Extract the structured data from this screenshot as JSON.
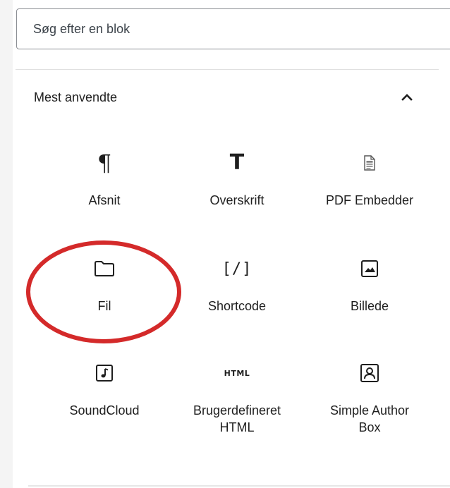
{
  "search": {
    "placeholder": "Søg efter en blok",
    "value": ""
  },
  "section": {
    "title": "Mest anvendte",
    "expanded": true,
    "chevron_icon": "chevron-up-icon"
  },
  "blocks": [
    {
      "label": "Afsnit",
      "icon": "paragraph-icon"
    },
    {
      "label": "Overskrift",
      "icon": "heading-icon"
    },
    {
      "label": "PDF Embedder",
      "icon": "pdf-document-icon"
    },
    {
      "label": "Fil",
      "icon": "folder-icon"
    },
    {
      "label": "Shortcode",
      "icon": "shortcode-icon",
      "glyph": "[/]"
    },
    {
      "label": "Billede",
      "icon": "image-icon"
    },
    {
      "label": "SoundCloud",
      "icon": "audio-icon"
    },
    {
      "label": "Brugerdefineret HTML",
      "icon": "html-icon",
      "glyph": "HTML"
    },
    {
      "label": "Simple Author Box",
      "icon": "author-box-icon"
    }
  ],
  "annotation": {
    "highlight_color": "#d42a2a",
    "highlighted_block": "Fil"
  },
  "colors": {
    "text": "#1e1e1e",
    "border": "#8c8f94",
    "divider": "#e0e0e0"
  }
}
